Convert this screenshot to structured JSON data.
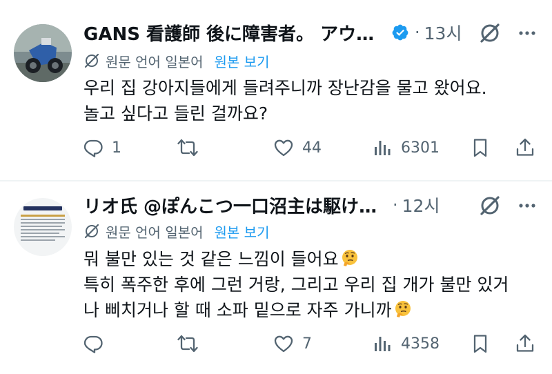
{
  "tweets": [
    {
      "display_name": "GANS 看護師 後に障害者。 アウト…",
      "verified": true,
      "time": "13시",
      "translation": {
        "language_note": "원문 언어 일본어",
        "show_original": "원본 보기"
      },
      "body": [
        "우리 집 강아지들에게 들려주니까 장난감을 물고 왔어요.",
        "놀고 싶다고 들린 걸까요?"
      ],
      "stats": {
        "replies": "1",
        "retweets": "",
        "likes": "44",
        "views": "6301"
      }
    },
    {
      "display_name": "リオ氏 @ぽんこつ一口沼主は駆け出しグ…",
      "verified": false,
      "time": "12시",
      "translation": {
        "language_note": "원문 언어 일본어",
        "show_original": "원본 보기"
      },
      "body": [
        "뭐 불만 있는 것 같은 느낌이 들어요",
        "특히 폭주한 후에 그런 거랑, 그리고 우리 집 개가 불만 있거",
        "나 삐치거나 할 때 소파 밑으로 자주 가니까"
      ],
      "body_emoji": "thinking-face",
      "stats": {
        "replies": "",
        "retweets": "",
        "likes": "7",
        "views": "4358"
      }
    }
  ],
  "colors": {
    "accent": "#1d9bf0",
    "secondary_text": "#536471",
    "text": "#0f1419",
    "divider": "#eff3f4"
  },
  "icons": [
    "grok-icon",
    "more-icon",
    "translate-icon",
    "reply-icon",
    "retweet-icon",
    "like-icon",
    "views-icon",
    "bookmark-icon",
    "share-icon",
    "verified-badge-icon",
    "thinking-face-emoji"
  ]
}
